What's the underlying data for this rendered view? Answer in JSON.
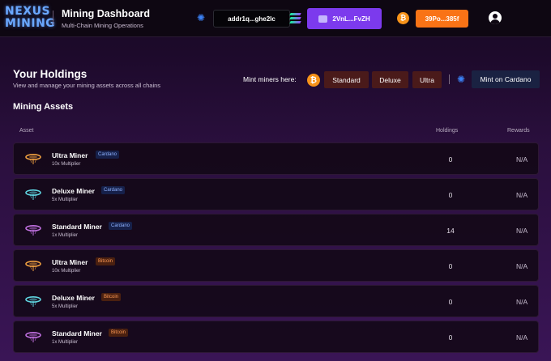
{
  "header": {
    "logo_line1": "NEXUS",
    "logo_line2": "MINING",
    "title": "Mining Dashboard",
    "subtitle": "Multi-Chain Mining Operations",
    "wallets": {
      "cardano": "addr1q...ghe2lc",
      "solana": "2VnL...FvZH",
      "bitcoin": "39Po...385f"
    }
  },
  "holdings": {
    "title": "Your Holdings",
    "subtitle": "View and manage your mining assets across all chains",
    "mint_label": "Mint miners here:",
    "mint_buttons": [
      "Standard",
      "Deluxe",
      "Ultra"
    ],
    "mint_cardano": "Mint on Cardano"
  },
  "assets": {
    "title": "Mining Assets",
    "columns": {
      "asset": "Asset",
      "holdings": "Holdings",
      "rewards": "Rewards"
    },
    "rows": [
      {
        "name": "Ultra Miner",
        "chain": "Cardano",
        "multiplier": "10x Multiplier",
        "holdings": "0",
        "rewards": "N/A",
        "icon_color": "#f0a040"
      },
      {
        "name": "Deluxe Miner",
        "chain": "Cardano",
        "multiplier": "5x Multiplier",
        "holdings": "0",
        "rewards": "N/A",
        "icon_color": "#5fd4e0"
      },
      {
        "name": "Standard Miner",
        "chain": "Cardano",
        "multiplier": "1x Multiplier",
        "holdings": "14",
        "rewards": "N/A",
        "icon_color": "#c070e0"
      },
      {
        "name": "Ultra Miner",
        "chain": "Bitcoin",
        "multiplier": "10x Multiplier",
        "holdings": "0",
        "rewards": "N/A",
        "icon_color": "#f0a040"
      },
      {
        "name": "Deluxe Miner",
        "chain": "Bitcoin",
        "multiplier": "5x Multiplier",
        "holdings": "0",
        "rewards": "N/A",
        "icon_color": "#5fd4e0"
      },
      {
        "name": "Standard Miner",
        "chain": "Bitcoin",
        "multiplier": "1x Multiplier",
        "holdings": "0",
        "rewards": "N/A",
        "icon_color": "#c070e0"
      }
    ]
  },
  "colors": {
    "accent_purple": "#7c3aed",
    "accent_orange": "#f97316",
    "cardano_blue": "#3b82f6",
    "bitcoin_orange": "#f7931a"
  },
  "icons": [
    "cardano-icon",
    "solana-icon",
    "bitcoin-icon",
    "ghost-wallet-icon",
    "user-icon",
    "miner-icon"
  ]
}
